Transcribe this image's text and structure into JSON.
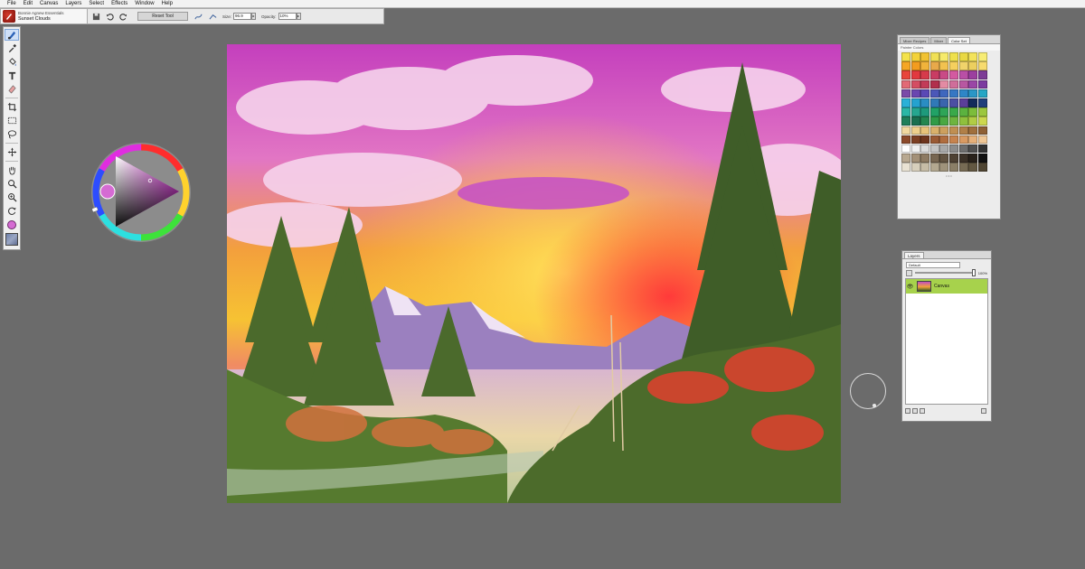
{
  "menu": [
    "File",
    "Edit",
    "Canvas",
    "Layers",
    "Select",
    "Effects",
    "Window",
    "Help"
  ],
  "property_bar": {
    "brush_category": "Bonnie Agnew Essentials",
    "brush_variant": "Sunset Clouds",
    "reset_tool_label": "Reset Tool",
    "size_label": "Size:",
    "size_value": "96.9",
    "opacity_label": "Opacity:",
    "opacity_value": "10%"
  },
  "toolbox": {
    "icons": [
      "brush-icon",
      "dropper-icon",
      "paint-bucket-icon",
      "text-icon",
      "eraser-icon",
      "crop-icon",
      "rectangle-select-icon",
      "lasso-icon",
      "transform-icon",
      "grabber-icon",
      "magnifier-icon",
      "zoom-icon",
      "rotate-icon"
    ],
    "main_color": "#d56bd3"
  },
  "color_panel": {
    "tabs": [
      "Mixer Recipes",
      "Mixer",
      "Color Set"
    ],
    "active_tab": "Color Set",
    "title": "Painter Colors",
    "swatches": [
      "#f4e24a",
      "#f3d23a",
      "#f1c232",
      "#f0e055",
      "#f6ea6b",
      "#efe04b",
      "#e9d843",
      "#f3e35a",
      "#f7ec74",
      "#f5a623",
      "#f39c1f",
      "#f0b33b",
      "#e8a94a",
      "#f2c24f",
      "#f5d05d",
      "#f0d36a",
      "#eccf5f",
      "#f7db6e",
      "#e8463b",
      "#e2393f",
      "#d63a4b",
      "#c93c63",
      "#c94a86",
      "#d35aa0",
      "#b94fa6",
      "#9c3f9f",
      "#7e3b96",
      "#e26a76",
      "#d44d63",
      "#c23b58",
      "#b12f4c",
      "#e38ba3",
      "#cf6e9a",
      "#b857a1",
      "#9a46a6",
      "#7b3aa0",
      "#7b4aa8",
      "#6a46b0",
      "#5a48b5",
      "#4b57b8",
      "#3f67be",
      "#3577c3",
      "#2e86c7",
      "#2a96c6",
      "#26a6c5",
      "#2ab1d8",
      "#25a2cf",
      "#2a8dc3",
      "#3079b8",
      "#3a64ad",
      "#4b4fa3",
      "#5b3f99",
      "#132b5a",
      "#1f3f7a",
      "#2bb7a6",
      "#26a68f",
      "#1e9a7b",
      "#21a266",
      "#2ea557",
      "#39a94a",
      "#5bb23f",
      "#7cbd3b",
      "#9cc73e",
      "#1f7f5a",
      "#1a6f4f",
      "#23864f",
      "#2f9b47",
      "#4aa842",
      "#6eb43f",
      "#8fc03d",
      "#b1cc45",
      "#cdd84f",
      "#f1d9a0",
      "#edcf8c",
      "#e6c27a",
      "#d9b16b",
      "#cda05e",
      "#c08f52",
      "#b17f47",
      "#a06f3d",
      "#8f6035",
      "#8c4a2a",
      "#7c3f23",
      "#6e351e",
      "#9a5a34",
      "#b06d3f",
      "#c7834e",
      "#d99a62",
      "#e6b07a",
      "#f0c796",
      "#ffffff",
      "#f0f0f0",
      "#dcdcdc",
      "#c4c4c4",
      "#a9a9a9",
      "#8c8c8c",
      "#6e6e6e",
      "#505050",
      "#333333",
      "#b8a890",
      "#a39077",
      "#8d7a62",
      "#776651",
      "#625341",
      "#4e4133",
      "#3b3127",
      "#29221b",
      "#111111",
      "#e9e2d3",
      "#d7cfbc",
      "#c6bca6",
      "#b3a890",
      "#9f937b",
      "#8b7f67",
      "#776b54",
      "#635842",
      "#4f4532"
    ]
  },
  "layers_panel": {
    "tab": "Layers",
    "composite_method": "Default",
    "opacity_value": "100%",
    "layers": [
      {
        "name": "Canvas",
        "visible": true,
        "selected": true
      }
    ]
  }
}
